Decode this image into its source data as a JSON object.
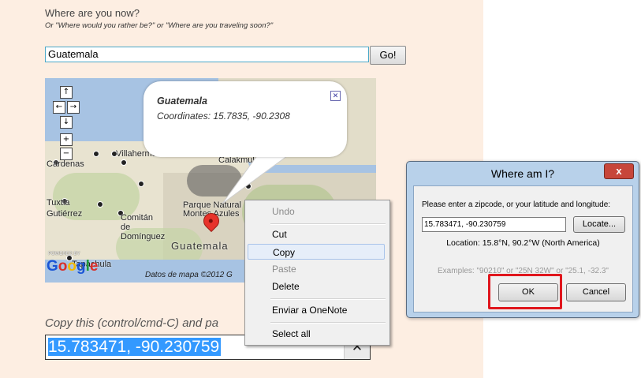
{
  "page": {
    "question_title": "Where are you now?",
    "question_subtitle": "Or \"Where would you rather be?\" or \"Where are you traveling soon?\"",
    "location_value": "Guatemala",
    "go_label": "Go!",
    "copy_instruction": "Copy this (control/cmd-C) and pa",
    "coords_value": "15.783471, -90.230759",
    "clear_symbol": "✕"
  },
  "map": {
    "places": [
      {
        "label": "Villahermosa"
      },
      {
        "label": "Cardenas"
      },
      {
        "label": "Tuxtla"
      },
      {
        "label": "Gutiérrez"
      },
      {
        "label": "Comitán"
      },
      {
        "label": "de"
      },
      {
        "label": "Domínguez"
      },
      {
        "label": "Tapachula"
      },
      {
        "label": "Calakmul"
      },
      {
        "label": "Parque Natural"
      },
      {
        "label": "Montes Azules"
      }
    ],
    "country_label": "Guatemala",
    "powered_by": "POWERED BY",
    "google": {
      "letters": [
        "G",
        "o",
        "o",
        "g",
        "l",
        "e"
      ],
      "colors": [
        "#1a55d6",
        "#d8302a",
        "#f2b800",
        "#1a55d6",
        "#1f9a3c",
        "#d8302a"
      ]
    },
    "attribution": "Datos de mapa ©2012 G",
    "controls": {
      "up": "↑",
      "left": "←",
      "right": "→",
      "down": "↓",
      "zoom_in": "+",
      "zoom_out": "−"
    },
    "popup": {
      "title": "Guatemala",
      "coordinates": "Coordinates: 15.7835, -90.2308",
      "close": "✕"
    }
  },
  "context_menu": {
    "items": [
      {
        "label": "Undo",
        "disabled": true
      },
      {
        "label": "Cut",
        "disabled": false
      },
      {
        "label": "Copy",
        "disabled": false,
        "highlighted": true
      },
      {
        "label": "Paste",
        "disabled": true
      },
      {
        "label": "Delete",
        "disabled": false
      },
      {
        "label": "Enviar a OneNote",
        "disabled": false
      },
      {
        "label": "Select all",
        "disabled": false
      }
    ]
  },
  "dialog": {
    "title": "Where am I?",
    "close": "x",
    "prompt": "Please enter a zipcode, or your latitude and longitude:",
    "input_value": "15.783471, -90.230759",
    "locate_label": "Locate...",
    "location_text": "Location: 15.8°N, 90.2°W (North America)",
    "examples": "Examples: \"90210\" or \"25N 32W\" or \"25.1, -32.3\"",
    "ok_label": "OK",
    "cancel_label": "Cancel"
  },
  "colors": {
    "page_background": "#fdeee2",
    "selection": "#3399ff",
    "highlight_box": "#e0161d",
    "pin": "#e7332b"
  }
}
